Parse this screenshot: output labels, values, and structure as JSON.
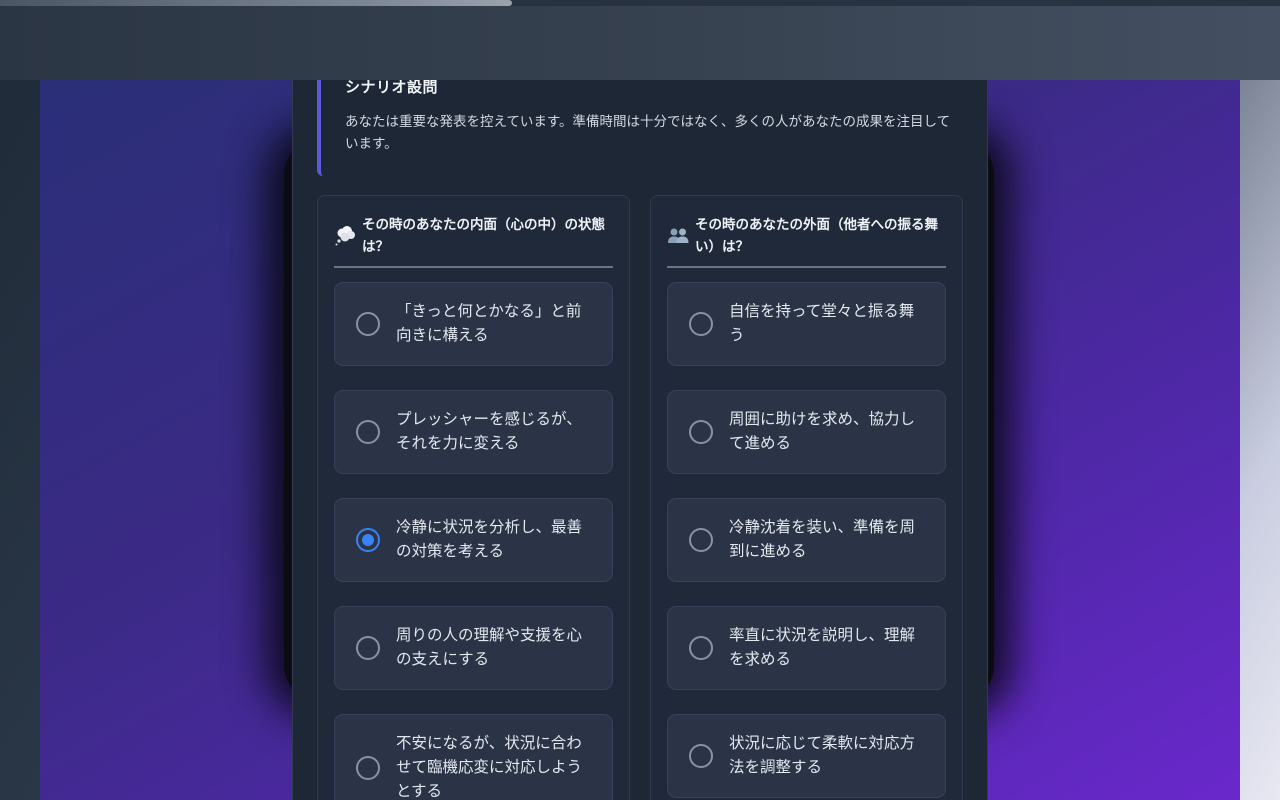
{
  "progress": {
    "fraction": 0.4
  },
  "scenario": {
    "title": "シナリオ設問",
    "text": "あなたは重要な発表を控えています。準備時間は十分ではなく、多くの人があなたの成果を注目しています。"
  },
  "inner": {
    "icon": "thought-bubble-icon",
    "title": "その時のあなたの内面（心の中）の状態は？",
    "options": [
      {
        "label": "「きっと何とかなる」と前向きに構える",
        "selected": false
      },
      {
        "label": "プレッシャーを感じるが、それを力に変える",
        "selected": false
      },
      {
        "label": "冷静に状況を分析し、最善の対策を考える",
        "selected": true
      },
      {
        "label": "周りの人の理解や支援を心の支えにする",
        "selected": false
      },
      {
        "label": "不安になるが、状況に合わせて臨機応変に対応しようとする",
        "selected": false
      }
    ]
  },
  "outer": {
    "icon": "people-icon",
    "title": "その時のあなたの外面（他者への振る舞い）は？",
    "options": [
      {
        "label": "自信を持って堂々と振る舞う",
        "selected": false
      },
      {
        "label": "周囲に助けを求め、協力して進める",
        "selected": false
      },
      {
        "label": "冷静沈着を装い、準備を周到に進める",
        "selected": false
      },
      {
        "label": "率直に状況を説明し、理解を求める",
        "selected": false
      },
      {
        "label": "状況に応じて柔軟に対応方法を調整する",
        "selected": false
      }
    ]
  },
  "colors": {
    "accent": "#3b82f6",
    "scenario_border": "#5b5bd6"
  }
}
